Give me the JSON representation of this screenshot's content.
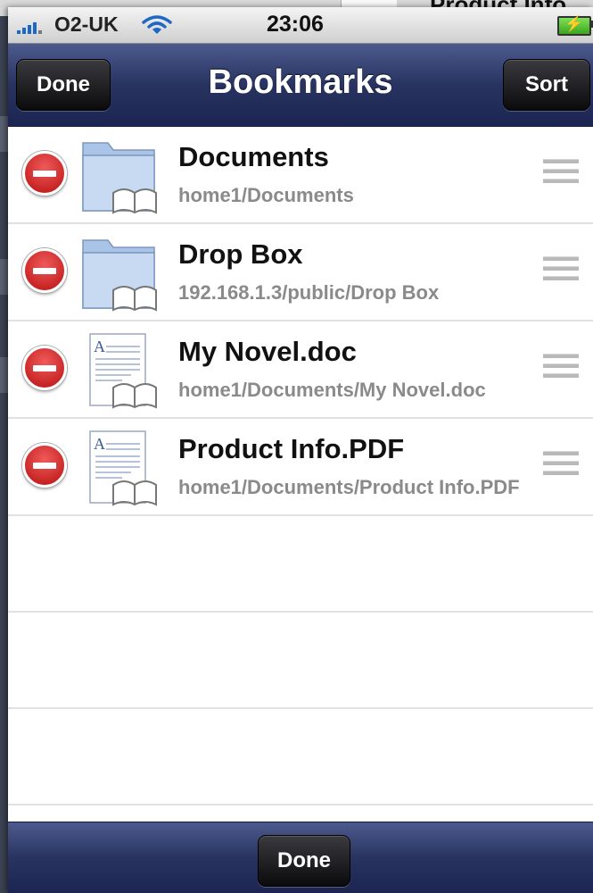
{
  "background": {
    "peek_title": "Product Info"
  },
  "status_bar": {
    "carrier": "O2-UK",
    "time": "23:06",
    "icons": [
      "signal-bars-icon",
      "wifi-icon",
      "battery-charging-icon"
    ]
  },
  "nav": {
    "title": "Bookmarks",
    "left_button": "Done",
    "right_button": "Sort"
  },
  "bookmarks": [
    {
      "name": "Documents",
      "path": "home1/Documents",
      "icon": "folder-bookmark-icon"
    },
    {
      "name": "Drop Box",
      "path": "192.168.1.3/public/Drop Box",
      "icon": "folder-bookmark-icon"
    },
    {
      "name": "My Novel.doc",
      "path": "home1/Documents/My Novel.doc",
      "icon": "document-bookmark-icon"
    },
    {
      "name": "Product Info.PDF",
      "path": "home1/Documents/Product Info.PDF",
      "icon": "document-bookmark-icon"
    }
  ],
  "toolbar": {
    "done_button": "Done"
  },
  "colors": {
    "bar_blue": "#28335f",
    "delete_red": "#d01818",
    "path_gray": "#8a8a8a"
  }
}
